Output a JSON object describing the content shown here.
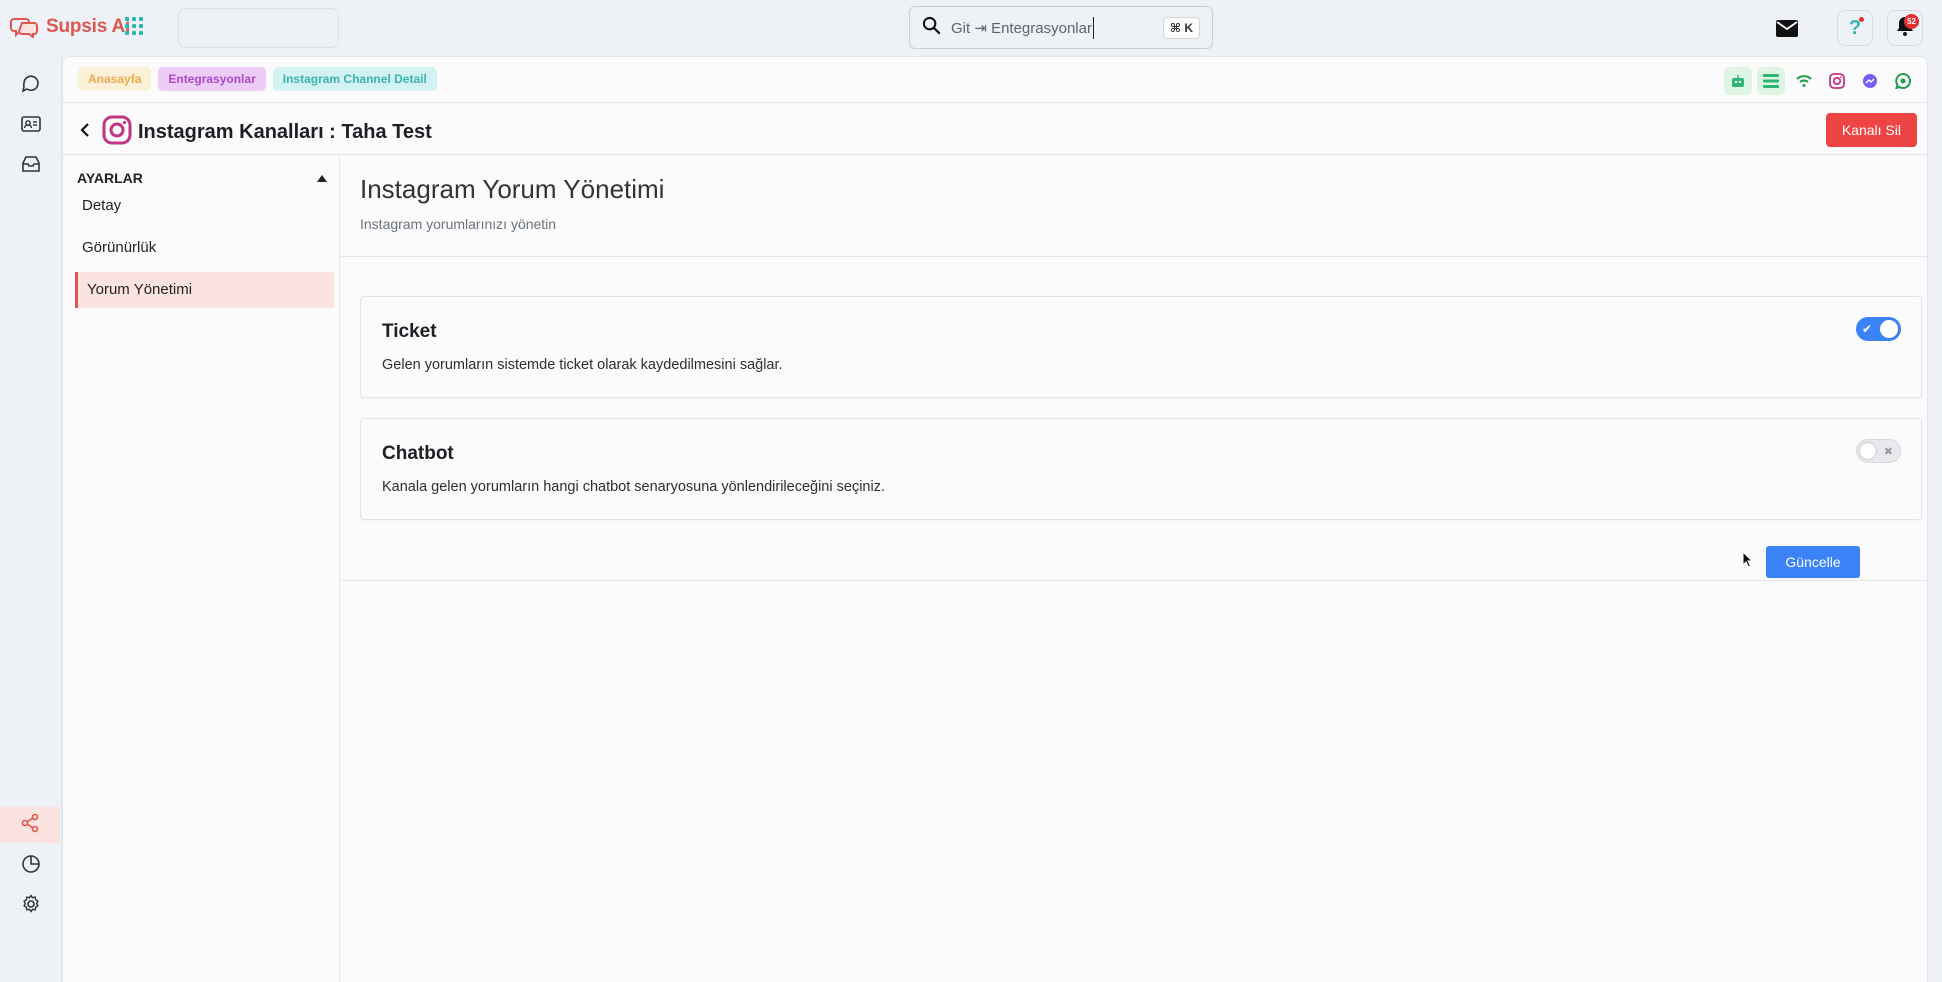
{
  "app": {
    "name": "Supsis Ai",
    "brand_color": "#e0574f"
  },
  "topbar": {
    "search_text": "Git ⇥ Entegrasyonlar",
    "search_shortcut": "⌘ K",
    "notification_count": "52"
  },
  "breadcrumbs": [
    "Anasayfa",
    "Entegrasyonlar",
    "Instagram Channel Detail"
  ],
  "header": {
    "title": "Instagram Kanalları : Taha Test",
    "delete_button": "Kanalı Sil"
  },
  "sidebar": {
    "section_title": "AYARLAR",
    "items": [
      {
        "label": "Detay",
        "active": false
      },
      {
        "label": "Görünürlük",
        "active": false
      },
      {
        "label": "Yorum Yönetimi",
        "active": true
      }
    ]
  },
  "content": {
    "title": "Instagram Yorum Yönetimi",
    "subtitle": "Instagram yorumlarınızı yönetin",
    "cards": [
      {
        "title": "Ticket",
        "description": "Gelen yorumların sistemde ticket olarak kaydedilmesini sağlar.",
        "enabled": true
      },
      {
        "title": "Chatbot",
        "description": "Kanala gelen yorumların hangi chatbot senaryosuna yönlendirileceğini seçiniz.",
        "enabled": false
      }
    ],
    "save_button": "Güncelle"
  },
  "colors": {
    "primary": "#3b82f6",
    "danger": "#ef4444",
    "active_bg": "#fbe3df"
  }
}
